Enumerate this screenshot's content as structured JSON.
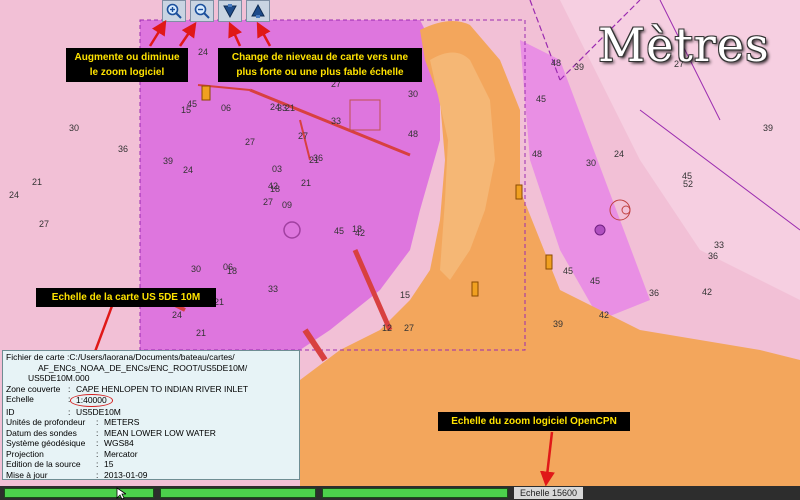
{
  "title": "Mètres",
  "toolbar": {
    "buttons": [
      {
        "name": "zoom-in-button",
        "icon": "zoom-in-icon"
      },
      {
        "name": "zoom-out-button",
        "icon": "zoom-out-icon"
      },
      {
        "name": "chart-down-button",
        "icon": "chart-scale-down-icon"
      },
      {
        "name": "chart-up-button",
        "icon": "chart-scale-up-icon"
      }
    ]
  },
  "annotations": {
    "zoom_line1": "Augmente ou diminue",
    "zoom_line2": "le zoom logiciel",
    "level_line1": "Change de nieveau de carte vers une",
    "level_line2": "plus forte ou une plus fable échelle",
    "chart_scale": "Echelle de la carte  US 5DE 10M",
    "software_zoom": "Echelle du zoom logiciel  OpenCPN"
  },
  "chart_info": {
    "file_label": "Fichier de carte : ",
    "file_line1": "C:/Users/laorana/Documents/bateau/cartes/",
    "file_line2": "AF_ENCs_NOAA_DE_ENCs/ENC_ROOT/US5DE10M/",
    "file_line3": "US5DE10M.000",
    "zone_label": "Zone couverte",
    "zone_value": "CAPE HENLOPEN TO INDIAN RIVER INLET",
    "scale_label": "Echelle",
    "scale_value": "1:40000",
    "id_label": "ID",
    "id_value": "US5DE10M",
    "units_label": "Unités de profondeur",
    "units_value": "METERS",
    "datum_label": "Datum des sondes",
    "datum_value": "MEAN LOWER LOW WATER",
    "geo_label": "Système géodésique",
    "geo_value": "WGS84",
    "proj_label": "Projection",
    "proj_value": "Mercator",
    "edition_label": "Edition de la source",
    "edition_value": "15",
    "update_label": "Mise à jour",
    "update_value": "2013-01-09"
  },
  "status": {
    "zoom_scale": "Echelle 15600"
  },
  "colors": {
    "land": "#f3a65c",
    "shallow": "#e07ae0",
    "deep": "#f2c0d6",
    "note_bg": "#000000",
    "note_text": "#ffe300"
  },
  "soundings": [
    "09",
    "15",
    "18",
    "15",
    "21",
    "18",
    "24",
    "21",
    "27",
    "21",
    "24",
    "27",
    "24",
    "30",
    "27",
    "33",
    "21",
    "24",
    "27",
    "30",
    "27",
    "24",
    "21",
    "33",
    "36",
    "42",
    "45",
    "42",
    "39",
    "45",
    "48",
    "42",
    "33",
    "03",
    "06",
    "09",
    "06",
    "12",
    "15",
    "18",
    "27",
    "24",
    "30",
    "36",
    "42",
    "48",
    "45",
    "39",
    "36",
    "52",
    "45",
    "39",
    "45",
    "33",
    "42",
    "45",
    "39",
    "48",
    "42",
    "36",
    "30",
    "27",
    "24",
    "21"
  ]
}
